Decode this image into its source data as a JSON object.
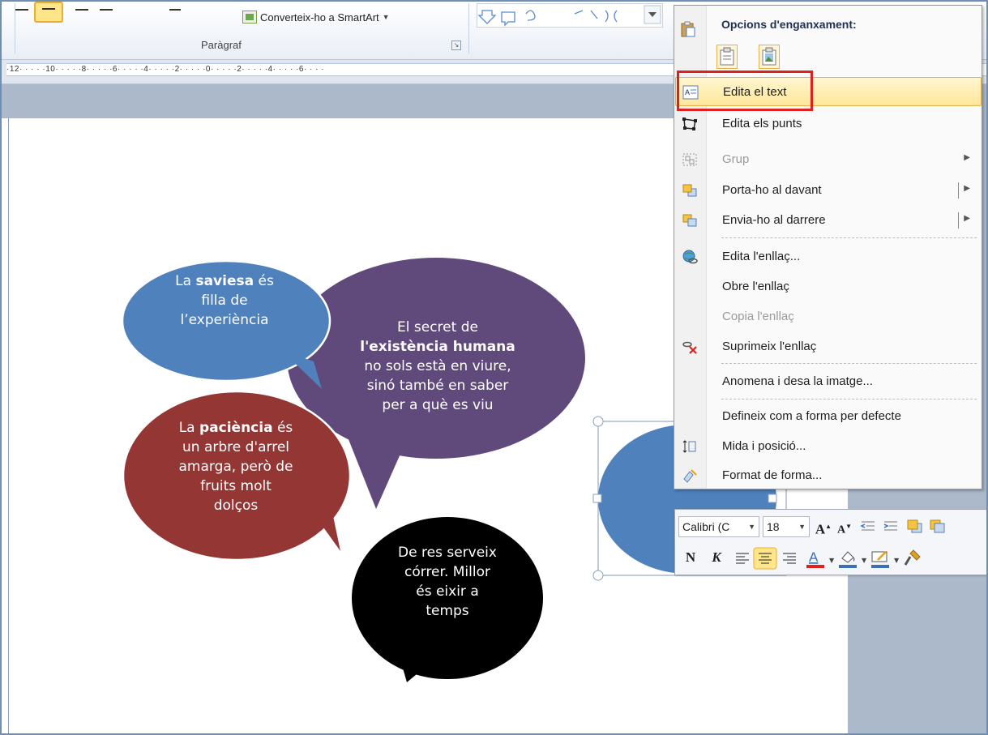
{
  "ribbon": {
    "convert_smartart": "Converteix-ho a SmartArt",
    "group_label": "Paràgraf"
  },
  "ruler": {
    "labels": "·12· · · · ·10· · · · ·8· · · · ·6· · · · ·4· · · · ·2· · · · ·0· · · · ·2· · · · ·4· · · · ·6· · · ·"
  },
  "bubbles": {
    "saviesa": {
      "pre": "La ",
      "bold": "saviesa",
      "post": " és",
      "line2": "filla de",
      "line3": "l’experiència",
      "color": "#4f81bd"
    },
    "secret": {
      "line1": "El secret de",
      "bold": "l'existència humana",
      "line3": "no sols està en viure,",
      "line4": "sinó també en saber",
      "line5": "per a què es viu",
      "color": "#604a7b"
    },
    "paciencia": {
      "pre": "La ",
      "bold": "paciència",
      "post": " és",
      "line2": "un arbre d'arrel",
      "line3": "amarga, però de",
      "line4": "fruits molt",
      "line5": "dolços",
      "color": "#943634"
    },
    "res": {
      "line1": "De res serveix",
      "line2": "córrer. Millor",
      "line3": "és eixir a",
      "line4": "temps",
      "color": "#000000"
    },
    "selected": {
      "color": "#4f81bd"
    }
  },
  "context_menu": {
    "header": "Opcions d'enganxament:",
    "items": [
      {
        "label": "Edita el text",
        "icon": "edit-text-icon"
      },
      {
        "label": "Edita els punts",
        "icon": "edit-points-icon"
      },
      {
        "label": "Grup",
        "icon": "group-icon",
        "disabled": true,
        "submenu": true
      },
      {
        "label": "Porta-ho al davant",
        "icon": "bring-front-icon",
        "submenu": true
      },
      {
        "label": "Envia-ho al darrere",
        "icon": "send-back-icon",
        "submenu": true
      },
      {
        "label": "Edita l'enllaç...",
        "icon": "hyperlink-icon"
      },
      {
        "label": "Obre l'enllaç",
        "icon": ""
      },
      {
        "label": "Copia l'enllaç",
        "icon": "",
        "disabled": true
      },
      {
        "label": "Suprimeix l'enllaç",
        "icon": "remove-link-icon"
      },
      {
        "label": "Anomena i desa la imatge...",
        "icon": ""
      },
      {
        "label": "Defineix com a forma per defecte",
        "icon": ""
      },
      {
        "label": "Mida i posició...",
        "icon": "size-position-icon"
      },
      {
        "label": "Format de forma...",
        "icon": "format-shape-icon"
      }
    ]
  },
  "mini_toolbar": {
    "font_name": "Calibri (C",
    "font_size": "18",
    "bold": "N",
    "italic": "K"
  },
  "colors": {
    "highlight_border": "#e01f1f",
    "menu_highlight": "#ffe79a",
    "font_color_bar": "#e01f1f"
  }
}
